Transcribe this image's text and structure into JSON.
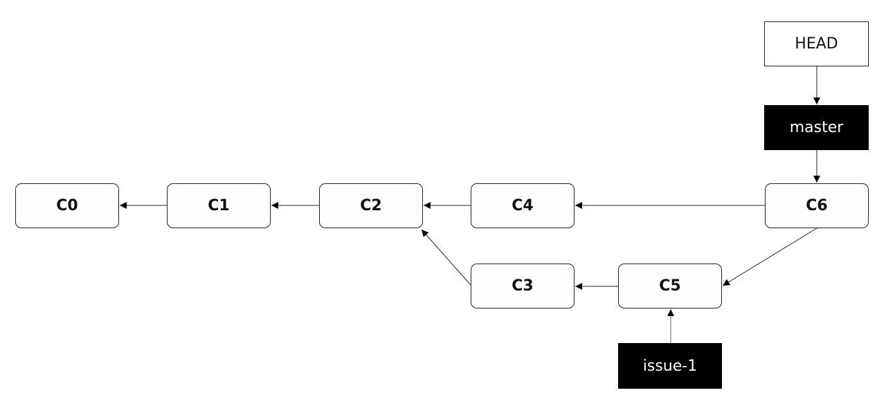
{
  "diagram": {
    "commits": [
      {
        "id": "C0",
        "label": "C0"
      },
      {
        "id": "C1",
        "label": "C1"
      },
      {
        "id": "C2",
        "label": "C2"
      },
      {
        "id": "C3",
        "label": "C3"
      },
      {
        "id": "C4",
        "label": "C4"
      },
      {
        "id": "C5",
        "label": "C5"
      },
      {
        "id": "C6",
        "label": "C6"
      }
    ],
    "refs": {
      "head": {
        "label": "HEAD",
        "points_to": "master"
      },
      "master": {
        "label": "master",
        "points_to": "C6"
      },
      "issue1": {
        "label": "issue-1",
        "points_to": "C5"
      }
    },
    "edges": [
      {
        "from": "C1",
        "to": "C0"
      },
      {
        "from": "C2",
        "to": "C1"
      },
      {
        "from": "C4",
        "to": "C2"
      },
      {
        "from": "C3",
        "to": "C2"
      },
      {
        "from": "C6",
        "to": "C4"
      },
      {
        "from": "C5",
        "to": "C3"
      },
      {
        "from": "C6",
        "to": "C5"
      },
      {
        "from": "HEAD",
        "to": "master"
      },
      {
        "from": "master",
        "to": "C6"
      },
      {
        "from": "issue-1",
        "to": "C5"
      }
    ]
  }
}
